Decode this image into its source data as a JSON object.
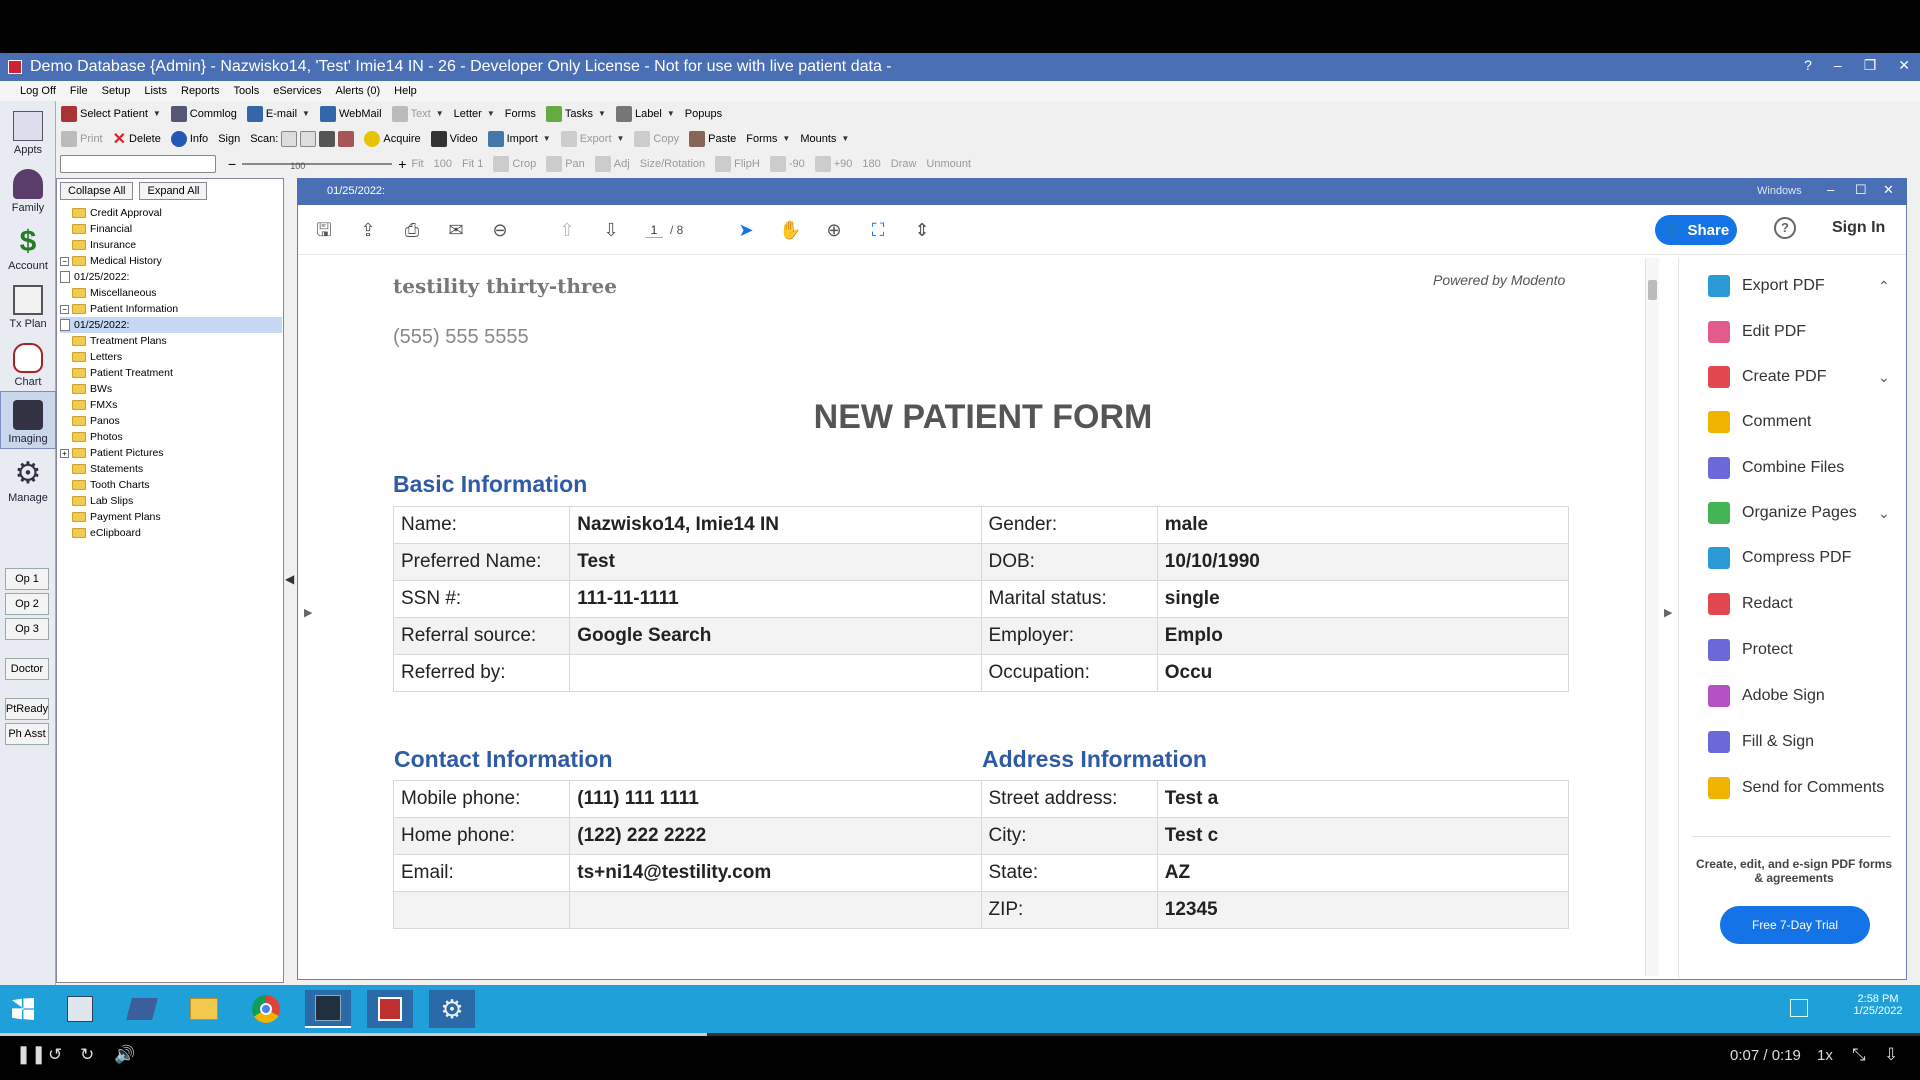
{
  "window": {
    "title": "Demo Database {Admin} - Nazwisko14, 'Test' Imie14 IN - 26 - Developer Only License - Not for use with live patient data -",
    "controls": [
      "?",
      "–",
      "❐",
      "✕"
    ]
  },
  "menu": [
    "Log Off",
    "File",
    "Setup",
    "Lists",
    "Reports",
    "Tools",
    "eServices",
    "Alerts (0)",
    "Help"
  ],
  "toolbar1": {
    "select_patient": "Select Patient",
    "commlog": "Commlog",
    "email": "E-mail",
    "webmail": "WebMail",
    "text": "Text",
    "letter": "Letter",
    "forms": "Forms",
    "tasks": "Tasks",
    "label": "Label",
    "popups": "Popups"
  },
  "toolbar2": {
    "print": "Print",
    "delete": "Delete",
    "info": "Info",
    "sign": "Sign",
    "scan": "Scan:",
    "acquire": "Acquire",
    "video": "Video",
    "import": "Import",
    "export": "Export",
    "copy": "Copy",
    "paste": "Paste",
    "forms": "Forms",
    "mounts": "Mounts"
  },
  "toolbar3": {
    "zoom_value": "100",
    "fit": "Fit",
    "z100": "100",
    "fit1": "Fit 1",
    "crop": "Crop",
    "pan": "Pan",
    "adj": "Adj",
    "size_rotation": "Size/Rotation",
    "fliph": "FlipH",
    "m90": "-90",
    "p90": "+90",
    "r180": "180",
    "draw": "Draw",
    "unmount": "Unmount"
  },
  "modules": [
    "Appts",
    "Family",
    "Account",
    "Tx Plan",
    "Chart",
    "Imaging",
    "Manage"
  ],
  "ops": [
    "Op 1",
    "Op 2",
    "Op 3",
    "Doctor",
    "PtReady",
    "Ph Asst"
  ],
  "tree": {
    "collapse_all": "Collapse All",
    "expand_all": "Expand All",
    "items": [
      {
        "label": "Credit Approval",
        "kind": "folder"
      },
      {
        "label": "Financial",
        "kind": "folder"
      },
      {
        "label": "Insurance",
        "kind": "folder"
      },
      {
        "label": "Medical History",
        "kind": "folder",
        "toggle": "−"
      },
      {
        "label": "01/25/2022:",
        "kind": "doc"
      },
      {
        "label": "Miscellaneous",
        "kind": "folder"
      },
      {
        "label": "Patient Information",
        "kind": "folder",
        "toggle": "−"
      },
      {
        "label": "01/25/2022:",
        "kind": "doc",
        "selected": true
      },
      {
        "label": "Treatment Plans",
        "kind": "folder"
      },
      {
        "label": "Letters",
        "kind": "folder"
      },
      {
        "label": "Patient Treatment",
        "kind": "folder"
      },
      {
        "label": "BWs",
        "kind": "folder"
      },
      {
        "label": "FMXs",
        "kind": "folder"
      },
      {
        "label": "Panos",
        "kind": "folder"
      },
      {
        "label": "Photos",
        "kind": "folder"
      },
      {
        "label": "Patient Pictures",
        "kind": "folder",
        "toggle": "+"
      },
      {
        "label": "Statements",
        "kind": "folder"
      },
      {
        "label": "Tooth Charts",
        "kind": "folder"
      },
      {
        "label": "Lab Slips",
        "kind": "folder"
      },
      {
        "label": "Payment Plans",
        "kind": "folder"
      },
      {
        "label": "eClipboard",
        "kind": "folder"
      }
    ]
  },
  "viewer": {
    "tab_date": "01/25/2022:",
    "os_label": "Windows",
    "page_current": "1",
    "page_total": "/ 8",
    "share": "Share",
    "sign_in": "Sign In"
  },
  "pdf": {
    "practice": "testility thirty-three",
    "phone": "(555) 555 5555",
    "powered": "Powered by Modento",
    "title": "NEW PATIENT FORM",
    "basic_heading": "Basic Information",
    "basic_rows": [
      [
        "Name:",
        "Nazwisko14, Imie14 IN",
        "Gender:",
        "male"
      ],
      [
        "Preferred Name:",
        "Test",
        "DOB:",
        "10/10/1990"
      ],
      [
        "SSN #:",
        "111-11-1111",
        "Marital status:",
        "single"
      ],
      [
        "Referral source:",
        "Google Search",
        "Employer:",
        "Emplo"
      ],
      [
        "Referred by:",
        "",
        "Occupation:",
        "Occu"
      ]
    ],
    "contact_heading": "Contact Information",
    "address_heading": "Address Information",
    "contact_rows": [
      [
        "Mobile phone:",
        "(111) 111 1111",
        "Street address:",
        "Test a"
      ],
      [
        "Home phone:",
        "(122) 222 2222",
        "City:",
        "Test c"
      ],
      [
        "Email:",
        "ts+ni14@testility.com",
        "State:",
        "AZ"
      ],
      [
        "",
        "",
        "ZIP:",
        "12345"
      ]
    ]
  },
  "tools": {
    "items": [
      {
        "label": "Export PDF",
        "color": "#2b9bd8",
        "chev": "⌃"
      },
      {
        "label": "Edit PDF",
        "color": "#e35b8a"
      },
      {
        "label": "Create PDF",
        "color": "#e34850",
        "chev": "⌄"
      },
      {
        "label": "Comment",
        "color": "#f0b400"
      },
      {
        "label": "Combine Files",
        "color": "#6b68d9"
      },
      {
        "label": "Organize Pages",
        "color": "#44b556",
        "chev": "⌄"
      },
      {
        "label": "Compress PDF",
        "color": "#2b9bd8"
      },
      {
        "label": "Redact",
        "color": "#e34850"
      },
      {
        "label": "Protect",
        "color": "#6b68d9"
      },
      {
        "label": "Adobe Sign",
        "color": "#b54fc4"
      },
      {
        "label": "Fill & Sign",
        "color": "#6b68d9"
      },
      {
        "label": "Send for Comments",
        "color": "#f0b400"
      }
    ],
    "promo": "Create, edit, and e-sign PDF forms & agreements",
    "trial": "Free 7-Day Trial"
  },
  "taskbar": {
    "time": "2:58 PM",
    "date": "1/25/2022"
  },
  "player": {
    "time": "0:07 / 0:19",
    "speed": "1x"
  }
}
